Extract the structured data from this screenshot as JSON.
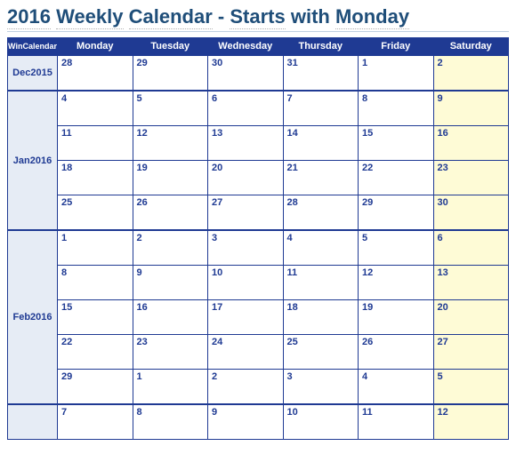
{
  "title_parts": [
    "2016",
    "Weekly",
    "Calendar",
    "-",
    "Starts",
    "with",
    "Monday"
  ],
  "corner_label": "WinCalendar",
  "days": [
    "Monday",
    "Tuesday",
    "Wednesday",
    "Thursday",
    "Friday",
    "Saturday"
  ],
  "months": [
    {
      "label": "Dec2015",
      "weeks": [
        {
          "mon": "28",
          "tue": "29",
          "wed": "30",
          "thu": "31",
          "fri": "1",
          "sat": "2"
        }
      ]
    },
    {
      "label": "Jan2016",
      "weeks": [
        {
          "mon": "4",
          "tue": "5",
          "wed": "6",
          "thu": "7",
          "fri": "8",
          "sat": "9"
        },
        {
          "mon": "11",
          "tue": "12",
          "wed": "13",
          "thu": "14",
          "fri": "15",
          "sat": "16"
        },
        {
          "mon": "18",
          "tue": "19",
          "wed": "20",
          "thu": "21",
          "fri": "22",
          "sat": "23"
        },
        {
          "mon": "25",
          "tue": "26",
          "wed": "27",
          "thu": "28",
          "fri": "29",
          "sat": "30"
        }
      ]
    },
    {
      "label": "Feb2016",
      "weeks": [
        {
          "mon": "1",
          "tue": "2",
          "wed": "3",
          "thu": "4",
          "fri": "5",
          "sat": "6"
        },
        {
          "mon": "8",
          "tue": "9",
          "wed": "10",
          "thu": "11",
          "fri": "12",
          "sat": "13"
        },
        {
          "mon": "15",
          "tue": "16",
          "wed": "17",
          "thu": "18",
          "fri": "19",
          "sat": "20"
        },
        {
          "mon": "22",
          "tue": "23",
          "wed": "24",
          "thu": "25",
          "fri": "26",
          "sat": "27"
        },
        {
          "mon": "29",
          "tue": "1",
          "wed": "2",
          "thu": "3",
          "fri": "4",
          "sat": "5"
        }
      ]
    },
    {
      "label": "",
      "weeks": [
        {
          "mon": "7",
          "tue": "8",
          "wed": "9",
          "thu": "10",
          "fri": "11",
          "sat": "12"
        }
      ]
    }
  ]
}
